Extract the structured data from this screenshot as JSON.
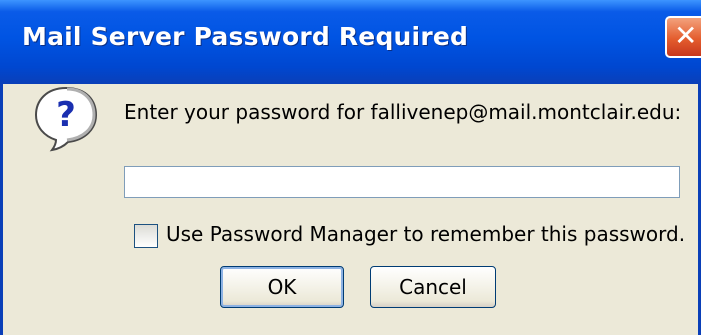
{
  "window": {
    "title": "Mail Server Password Required",
    "close_symbol": "✕",
    "accent_title_blue": "#0054e3",
    "close_red": "#e45d2e"
  },
  "icon": "question-icon",
  "message": "Enter your password for fallivenep@mail.montclair.edu:",
  "password_input": {
    "value": "",
    "placeholder": ""
  },
  "remember": {
    "label": "Use Password Manager to remember this password.",
    "checked": false
  },
  "buttons": {
    "ok": "OK",
    "cancel": "Cancel"
  }
}
